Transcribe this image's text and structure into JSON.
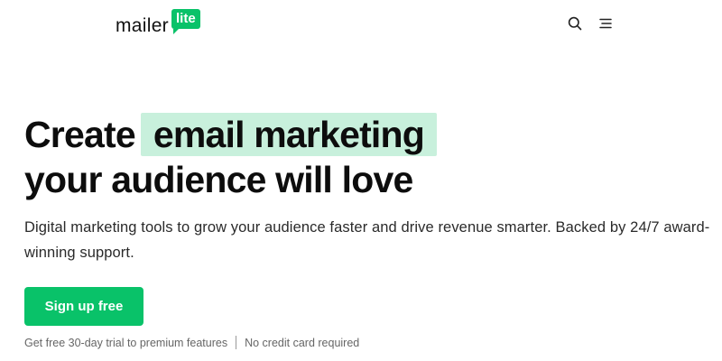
{
  "header": {
    "logo": {
      "text": "mailer",
      "badge": "lite"
    },
    "icons": {
      "search": "search-icon",
      "menu": "menu-icon"
    }
  },
  "hero": {
    "headline": {
      "prefix": "Create",
      "highlight": "email marketing",
      "line2": "your audience will love"
    },
    "subtitle": "Digital marketing tools to grow your audience faster and drive revenue smarter. Backed by 24/7 award-winning support.",
    "cta_label": "Sign up free",
    "footnote": {
      "trial": "Get free 30-day trial to premium features",
      "no_card": "No credit card required"
    }
  },
  "colors": {
    "brand_green": "#09c269",
    "highlight_bg": "#c8f0dc",
    "text": "#0d0d0d"
  }
}
